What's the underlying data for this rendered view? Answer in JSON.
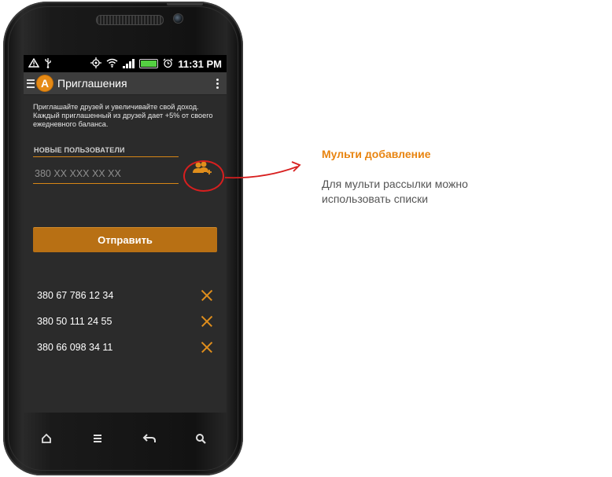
{
  "status_bar": {
    "time": "11:31 PM",
    "icons": [
      "warning-icon",
      "usb-icon",
      "gps-icon",
      "wifi-icon",
      "signal-icon",
      "battery-icon",
      "alarm-icon"
    ]
  },
  "app_bar": {
    "logo_letter": "A",
    "title": "Приглашения"
  },
  "intro_text": "Приглашайте друзей и увеличивайте свой доход. Каждый приглашенный из друзей дает +5% от своего ежедневного баланса.",
  "new_users": {
    "label": "НОВЫЕ ПОЛЬЗОВАТЕЛИ",
    "placeholder": "380 XX XXX XX XX"
  },
  "send_button": "Отправить",
  "invited": [
    {
      "number": "380 67 786 12 34"
    },
    {
      "number": "380 50 111 24 55"
    },
    {
      "number": "380 66 098 34 11"
    }
  ],
  "annotation": {
    "title": "Мульти добавление",
    "text": "Для мульти рассылки можно использовать списки"
  },
  "colors": {
    "accent": "#d78616",
    "button": "#b87014",
    "callout": "#d81f1f",
    "note_title": "#e88410"
  }
}
